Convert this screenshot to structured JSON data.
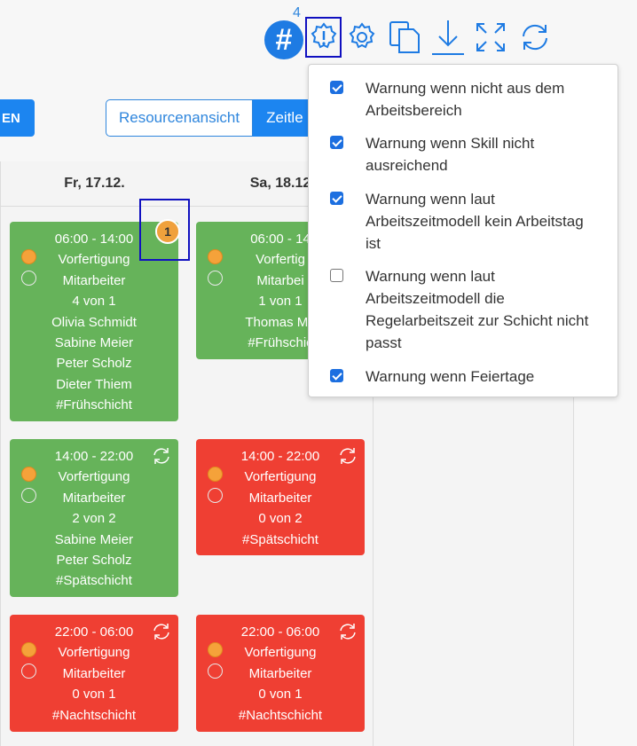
{
  "toolbar": {
    "hash_label": "#",
    "hash_count": "4",
    "icons": [
      "hash-icon",
      "warning-gear-icon",
      "gear-icon",
      "copy-icon",
      "download-icon",
      "fullscreen-icon",
      "refresh-icon"
    ]
  },
  "view": {
    "left_button": "EN",
    "resource_view": "Resourcenansicht",
    "time_view": "Zeitle"
  },
  "columns": [
    {
      "header": "Fr, 17.12."
    },
    {
      "header": "Sa, 18.12"
    }
  ],
  "shifts": {
    "fri_early": {
      "time": "06:00 - 14:00",
      "area": "Vorfertigung",
      "role": "Mitarbeiter",
      "count": "4 von 1",
      "people": [
        "Olivia Schmidt",
        "Sabine Meier",
        "Peter Scholz",
        "Dieter Thiem"
      ],
      "tag": "#Frühschicht"
    },
    "fri_late": {
      "time": "14:00 - 22:00",
      "area": "Vorfertigung",
      "role": "Mitarbeiter",
      "count": "2 von 2",
      "people": [
        "Sabine Meier",
        "Peter Scholz"
      ],
      "tag": "#Spätschicht"
    },
    "fri_night": {
      "time": "22:00 - 06:00",
      "area": "Vorfertigung",
      "role": "Mitarbeiter",
      "count": "0 von 1",
      "tag": "#Nachtschicht"
    },
    "sat_early": {
      "time": "06:00 - 14",
      "area": "Vorfertig",
      "role": "Mitarbei",
      "count": "1 von 1",
      "people": [
        "Thomas Mü"
      ],
      "tag": "#Frühschic"
    },
    "sat_late": {
      "time": "14:00 - 22:00",
      "area": "Vorfertigung",
      "role": "Mitarbeiter",
      "count": "0 von 2",
      "tag": "#Spätschicht"
    },
    "sat_night": {
      "time": "22:00 - 06:00",
      "area": "Vorfertigung",
      "role": "Mitarbeiter",
      "count": "0 von 1",
      "tag": "#Nachtschicht"
    }
  },
  "badge": {
    "count": "1"
  },
  "dropdown": {
    "items": [
      {
        "label": "Warnung wenn nicht aus dem Arbeitsbereich",
        "checked": true
      },
      {
        "label": "Warnung wenn Skill nicht ausreichend",
        "checked": true
      },
      {
        "label": "Warnung wenn laut Arbeitszeitmodell kein Arbeitstag ist",
        "checked": true
      },
      {
        "label": "Warnung wenn laut Arbeitszeitmodell die Regelarbeitszeit zur Schicht nicht passt",
        "checked": false
      },
      {
        "label": "Warnung wenn Feiertage",
        "checked": true
      }
    ]
  },
  "colors": {
    "accent": "#1c85f0",
    "green": "#66b35a",
    "red": "#ef3f33",
    "orange": "#f5a23a"
  }
}
